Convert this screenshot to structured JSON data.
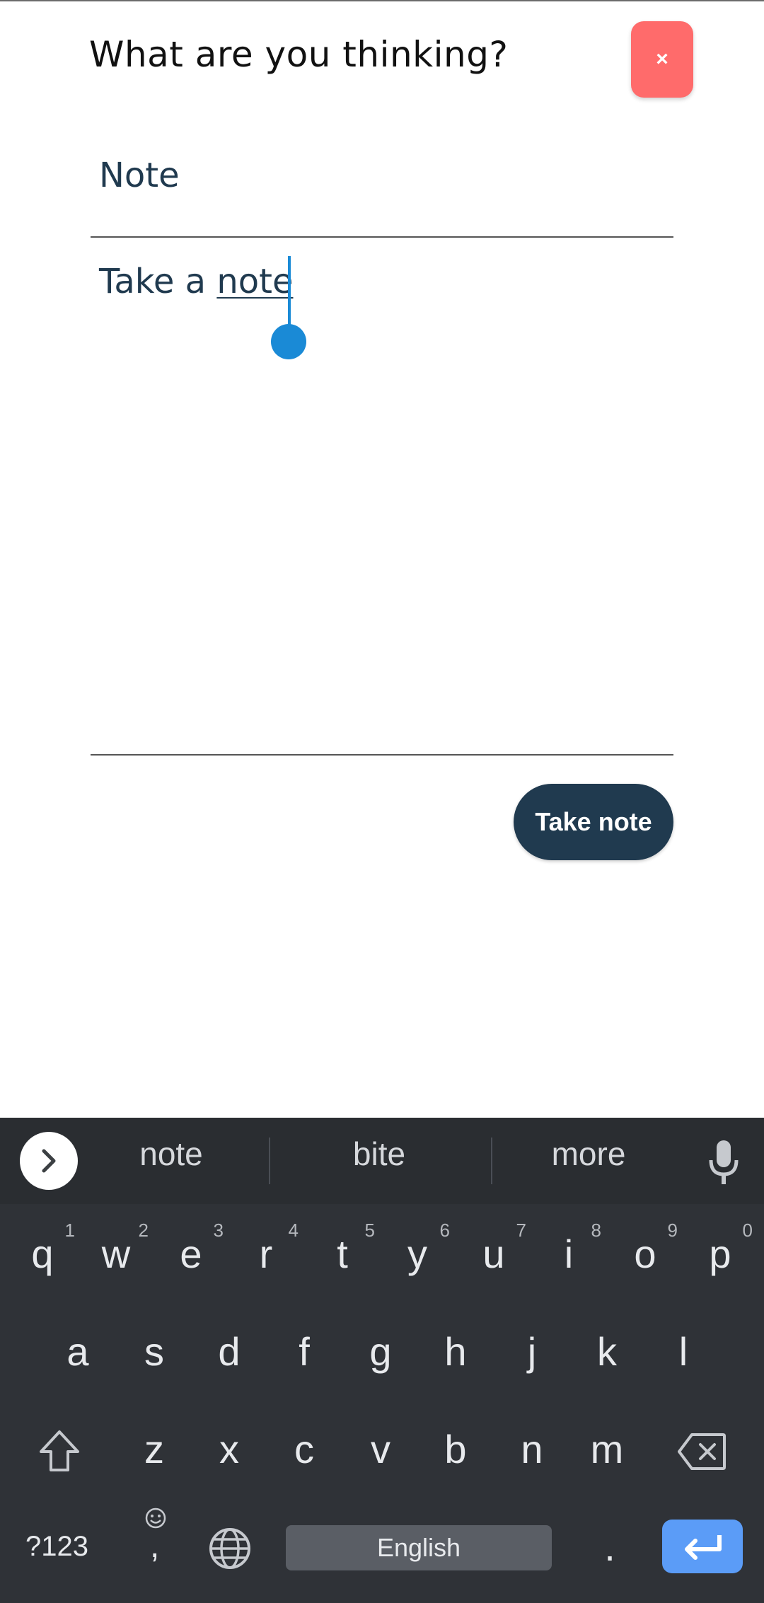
{
  "header": {
    "title": "What are you thinking?",
    "close_label": "×"
  },
  "form": {
    "title_value": "Note",
    "body_prefix": "Take a ",
    "body_composing": "note",
    "submit_label": "Take note"
  },
  "colors": {
    "close_button": "#ff6b6b",
    "primary": "#203a4f",
    "cursor": "#1a8ad6",
    "keyboard_bg": "#2f3237",
    "enter_key": "#5b9cf7"
  },
  "keyboard": {
    "suggestions": [
      "note",
      "bite",
      "more"
    ],
    "row1": [
      {
        "key": "q",
        "hint": "1"
      },
      {
        "key": "w",
        "hint": "2"
      },
      {
        "key": "e",
        "hint": "3"
      },
      {
        "key": "r",
        "hint": "4"
      },
      {
        "key": "t",
        "hint": "5"
      },
      {
        "key": "y",
        "hint": "6"
      },
      {
        "key": "u",
        "hint": "7"
      },
      {
        "key": "i",
        "hint": "8"
      },
      {
        "key": "o",
        "hint": "9"
      },
      {
        "key": "p",
        "hint": "0"
      }
    ],
    "row2": [
      "a",
      "s",
      "d",
      "f",
      "g",
      "h",
      "j",
      "k",
      "l"
    ],
    "row3": [
      "z",
      "x",
      "c",
      "v",
      "b",
      "n",
      "m"
    ],
    "symbols_label": "?123",
    "comma_label": ",",
    "space_label": "English",
    "period_label": ".",
    "icons": [
      "expand-chevron-icon",
      "microphone-icon",
      "shift-icon",
      "backspace-icon",
      "emoji-icon",
      "globe-icon",
      "enter-icon"
    ]
  }
}
